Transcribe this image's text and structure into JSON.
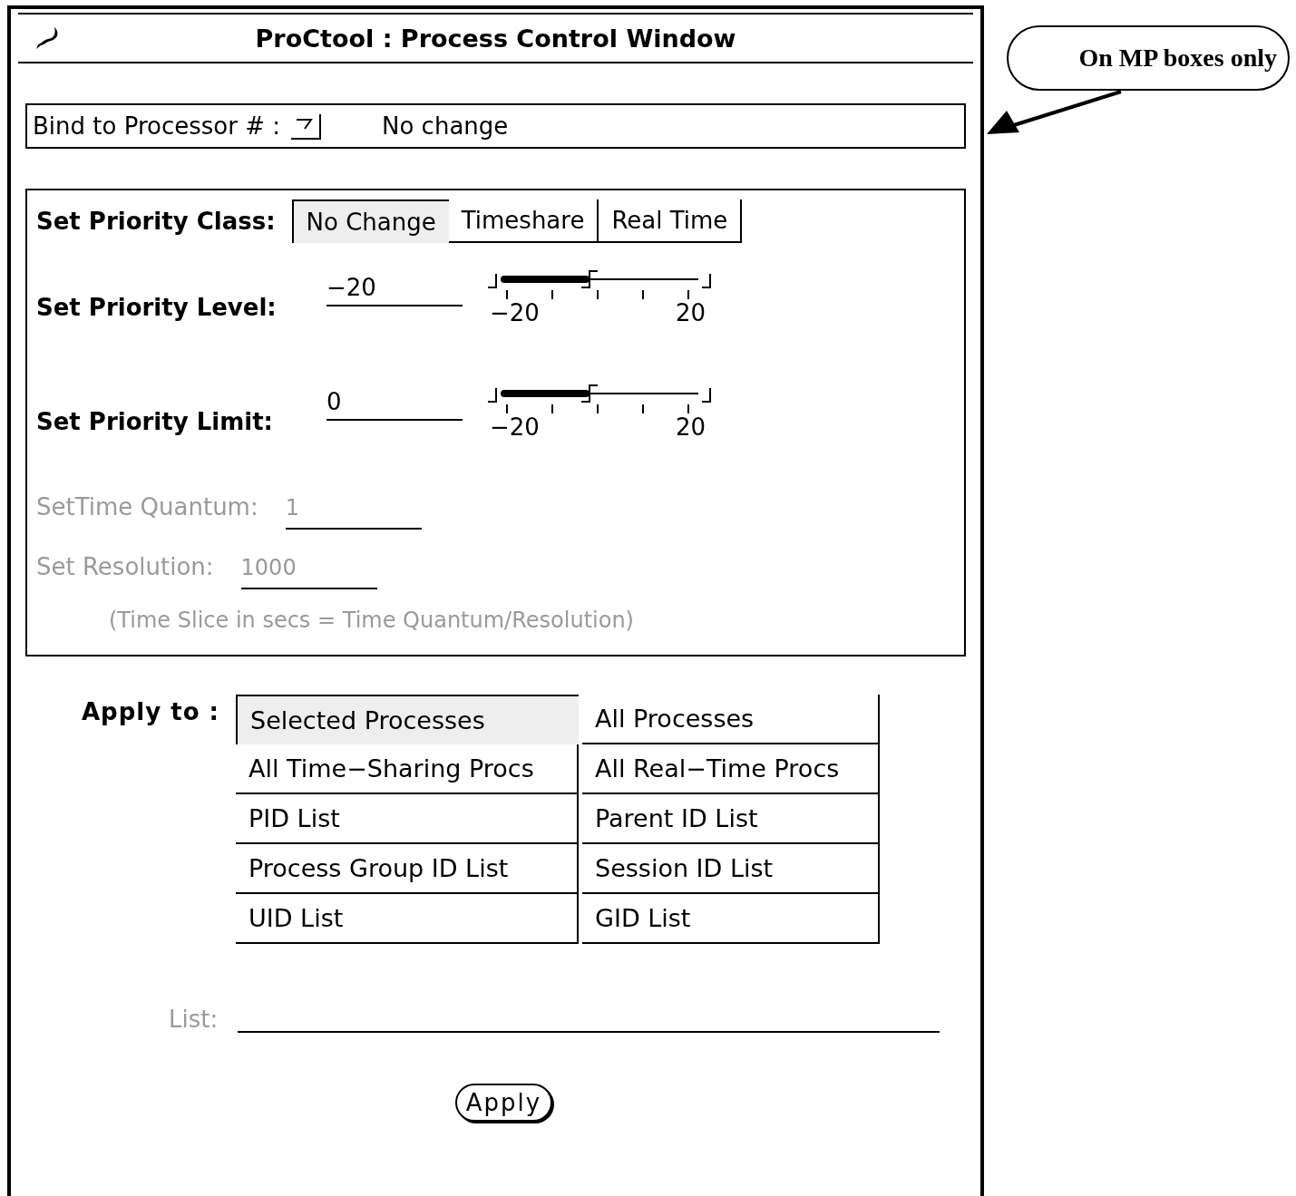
{
  "window": {
    "title": "ProCtool : Process Control Window"
  },
  "processor_binding": {
    "label": "Bind to Processor # :",
    "value": "No change"
  },
  "priority_class": {
    "label": "Set Priority Class:",
    "options": [
      {
        "label": "No Change",
        "selected": true
      },
      {
        "label": "Timeshare",
        "selected": false
      },
      {
        "label": "Real Time",
        "selected": false
      }
    ]
  },
  "sliders": [
    {
      "label": "Set Priority Level:",
      "value": "−20",
      "level": 0.45,
      "min_label": "−20",
      "max_label": "20"
    },
    {
      "label": "Set Priority Limit:",
      "value": "0",
      "level": 0.45,
      "min_label": "−20",
      "max_label": "20"
    }
  ],
  "quantum_fields": [
    {
      "label": "SetTime Quantum:",
      "value": "1",
      "disabled": true
    },
    {
      "label": "Set Resolution:",
      "value": "1000",
      "disabled": true
    }
  ],
  "note": {
    "text": "(Time Slice in secs = Time Quantum/Resolution)",
    "disabled": true
  },
  "apply_to": {
    "label": "Apply to :",
    "options": [
      {
        "label": "Selected Processes",
        "selected": true
      },
      {
        "label": "All Processes",
        "selected": false
      },
      {
        "label": "All Time−Sharing Procs",
        "selected": false
      },
      {
        "label": "All Real−Time Procs",
        "selected": false
      },
      {
        "label": "PID List",
        "selected": false
      },
      {
        "label": "Parent ID List",
        "selected": false
      },
      {
        "label": "Process Group ID List",
        "selected": false
      },
      {
        "label": "Session ID List",
        "selected": false
      },
      {
        "label": "UID List",
        "selected": false
      },
      {
        "label": "GID List",
        "selected": false
      }
    ]
  },
  "list_field": {
    "label": "List:",
    "disabled": true
  },
  "apply_button": "Apply",
  "callout": {
    "text": "On MP boxes only"
  }
}
